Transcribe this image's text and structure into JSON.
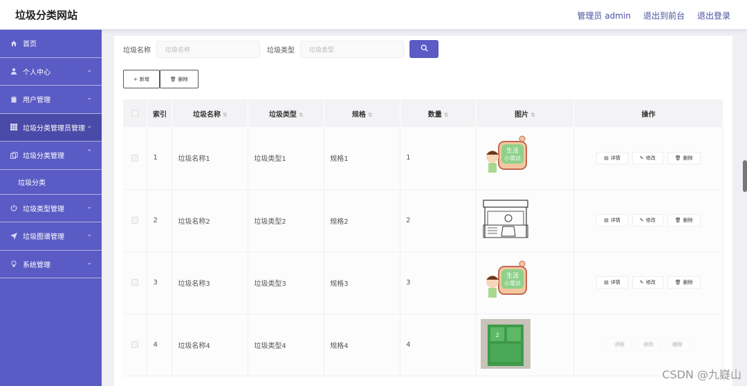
{
  "header": {
    "site_title": "垃圾分类网站",
    "admin_label": "管理员 admin",
    "front_link": "退出到前台",
    "logout_link": "退出登录"
  },
  "sidebar": {
    "items": [
      {
        "label": "首页",
        "icon": "home-icon",
        "chevron": false
      },
      {
        "label": "个人中心",
        "icon": "user-icon",
        "chevron": true
      },
      {
        "label": "用户管理",
        "icon": "clipboard-icon",
        "chevron": true
      },
      {
        "label": "垃圾分类管理员管理",
        "icon": "grid-icon",
        "chevron": true,
        "active": true
      },
      {
        "label": "垃圾分类管理",
        "icon": "copy-icon",
        "chevron": true,
        "expanded": true
      }
    ],
    "submenu": {
      "label": "垃圾分类"
    },
    "items2": [
      {
        "label": "垃圾类型管理",
        "icon": "power-icon"
      },
      {
        "label": "垃圾图谱管理",
        "icon": "send-icon"
      },
      {
        "label": "系统管理",
        "icon": "bulb-icon"
      }
    ]
  },
  "search": {
    "name_label": "垃圾名称",
    "name_placeholder": "垃圾名称",
    "type_label": "垃圾类型",
    "type_placeholder": "垃圾类型"
  },
  "toolbar": {
    "add_label": "新增",
    "delete_label": "删除"
  },
  "table": {
    "headers": {
      "index": "索引",
      "name": "垃圾名称",
      "type": "垃圾类型",
      "spec": "规格",
      "qty": "数量",
      "image": "图片",
      "ops": "操作"
    },
    "ops": {
      "detail": "详情",
      "edit": "修改",
      "delete": "删除"
    },
    "rows": [
      {
        "index": "1",
        "name": "垃圾名称1",
        "type": "垃圾类型1",
        "spec": "规格1",
        "qty": "1",
        "image": "life-tips-cartoon"
      },
      {
        "index": "2",
        "name": "垃圾名称2",
        "type": "垃圾类型2",
        "spec": "规格2",
        "qty": "2",
        "image": "shop-sketch"
      },
      {
        "index": "3",
        "name": "垃圾名称3",
        "type": "垃圾类型3",
        "spec": "规格3",
        "qty": "3",
        "image": "life-tips-cartoon"
      },
      {
        "index": "4",
        "name": "垃圾名称4",
        "type": "垃圾类型4",
        "spec": "规格4",
        "qty": "4",
        "image": "green-bin-photo"
      }
    ]
  },
  "watermark": "CSDN @九嶷山",
  "colors": {
    "accent": "#5a5bc4",
    "sidebar": "#5a5bc4"
  }
}
